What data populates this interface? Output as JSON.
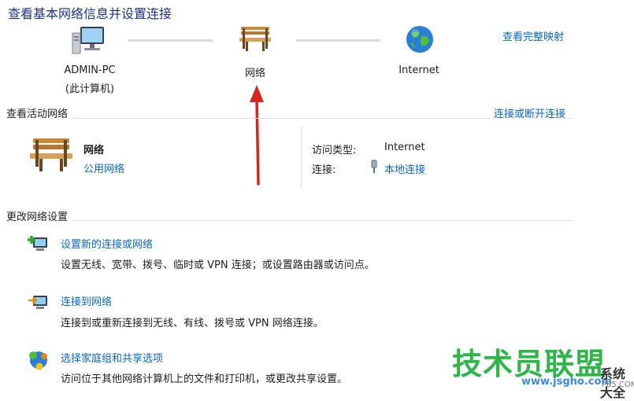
{
  "header": {
    "title": "查看基本网络信息并设置连接",
    "full_map_link": "查看完整映射"
  },
  "map": {
    "pc_name": "ADMIN-PC",
    "pc_sub": "(此计算机)",
    "network_label": "网络",
    "internet_label": "Internet"
  },
  "active": {
    "section_label": "查看活动网络",
    "connect_link": "连接或断开连接",
    "network_name": "网络",
    "network_type": "公用网络",
    "access_type_label": "访问类型:",
    "access_type_value": "Internet",
    "connections_label": "连接:",
    "connections_value": "本地连接"
  },
  "change": {
    "section_label": "更改网络设置",
    "tasks": [
      {
        "title": "设置新的连接或网络",
        "desc": "设置无线、宽带、拨号、临时或 VPN 连接；或设置路由器或访问点。",
        "icon": "new-connection-icon"
      },
      {
        "title": "连接到网络",
        "desc": "连接到或重新连接到无线、有线、拨号或 VPN 网络连接。",
        "icon": "connect-network-icon"
      },
      {
        "title": "选择家庭组和共享选项",
        "desc": "访问位于其他网络计算机上的文件和打印机，或更改共享设置。",
        "icon": "homegroup-icon"
      }
    ]
  },
  "watermark": {
    "main": "技术员联盟",
    "url": "www.jsgho.com",
    "side": "系统大全",
    "side_url": "P85.COM"
  },
  "colors": {
    "title": "#1e3287",
    "link": "#0b66c6",
    "arrow": "#d9231f",
    "watermark": "#2fb54a"
  }
}
